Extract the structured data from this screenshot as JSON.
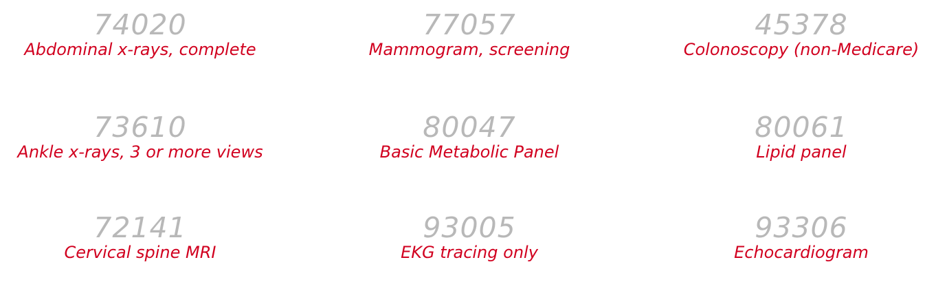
{
  "items": [
    {
      "code": "74020",
      "label": "Abdominal x-rays, complete"
    },
    {
      "code": "77057",
      "label": "Mammogram, screening"
    },
    {
      "code": "45378",
      "label": "Colonoscopy (non-Medicare)"
    },
    {
      "code": "73610",
      "label": "Ankle x-rays, 3 or more views"
    },
    {
      "code": "80047",
      "label": "Basic Metabolic Panel"
    },
    {
      "code": "80061",
      "label": "Lipid panel"
    },
    {
      "code": "72141",
      "label": "Cervical spine MRI"
    },
    {
      "code": "93005",
      "label": "EKG tracing only"
    },
    {
      "code": "93306",
      "label": "Echocardiogram"
    }
  ],
  "colors": {
    "code": "#b8b8b8",
    "label": "#d1001f",
    "background": "#ffffff"
  }
}
